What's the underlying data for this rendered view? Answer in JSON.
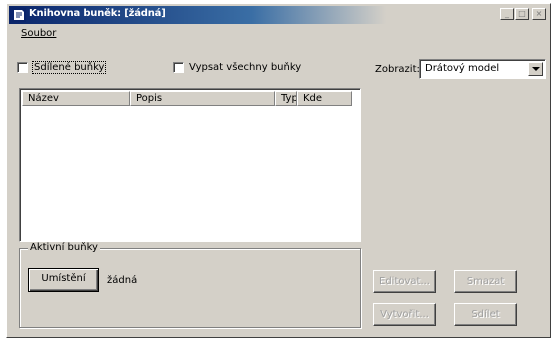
{
  "window": {
    "title": "Knihovna buněk: [žádná]",
    "minimize_glyph": "_",
    "maximize_glyph": "□",
    "close_glyph": "×"
  },
  "menu": {
    "file": "Soubor"
  },
  "options": {
    "shared_cells": "Sdílené buňky",
    "calc_all_cells": "Vypsat všechny buňky"
  },
  "view": {
    "label": "Zobrazit:",
    "selected": "Drátový model"
  },
  "list": {
    "columns": [
      "Název",
      "Popis",
      "Typ",
      "Kde"
    ]
  },
  "active_cells": {
    "group_title": "Aktivní buňky",
    "place_button": "Umístění",
    "value": "žádná"
  },
  "actions": {
    "edit": "Editovat...",
    "delete": "Smazat",
    "create": "Vytvořit...",
    "share": "Sdílet"
  },
  "colors": {
    "face": "#d4d0c8",
    "title_start": "#0a246a",
    "title_end": "#3a6ea5",
    "disabled_text": "#a0a0a0"
  }
}
